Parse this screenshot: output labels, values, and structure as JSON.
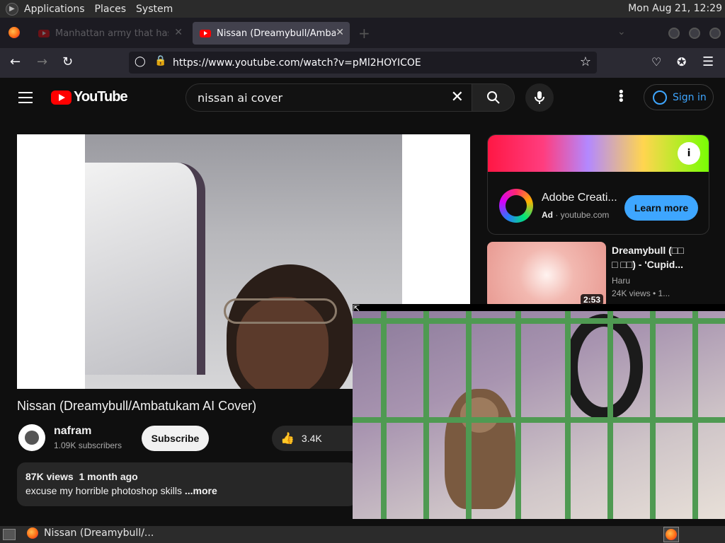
{
  "top_panel": {
    "menus": [
      "Applications",
      "Places",
      "System"
    ],
    "clock": "Mon Aug 21, 12:29"
  },
  "browser": {
    "tabs": [
      {
        "title": "Manhattan army that has c",
        "active": false
      },
      {
        "title": "Nissan (Dreamybull/Ambatu",
        "active": true
      }
    ],
    "url": "https://www.youtube.com/watch?v=pMl2HOYICOE"
  },
  "youtube": {
    "logo_text": "YouTube",
    "search_value": "nissan ai cover",
    "sign_in_label": "Sign in",
    "video": {
      "title": "Nissan (Dreamybull/Ambatukam AI Cover)",
      "channel": "nafram",
      "subscribers": "1.09K subscribers",
      "subscribe_label": "Subscribe",
      "likes": "3.4K",
      "views": "87K views",
      "age": "1 month ago",
      "description": "excuse my horrible photoshop skills",
      "more_label": "...more"
    },
    "ad": {
      "title": "Adobe Creati...",
      "badge": "Ad",
      "domain": "youtube.com",
      "cta_label": "Learn more"
    },
    "recommendations": [
      {
        "title_line1": "Dreamybull (□□",
        "title_line2": "□ □□) - 'Cupid...",
        "channel": "Haru",
        "meta": "24K views • 1...",
        "duration": "2:53"
      }
    ]
  },
  "taskbar": {
    "task_label": "Nissan (Dreamybull/..."
  },
  "colors": {
    "yt_red": "#ff0000",
    "yt_blue": "#3ea6ff",
    "page_bg": "#0f0f0f"
  }
}
